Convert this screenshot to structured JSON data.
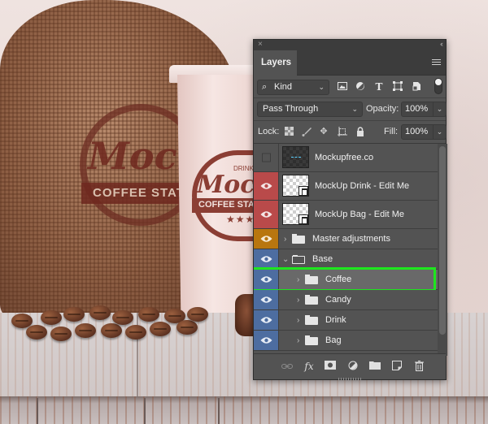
{
  "scene": {
    "bag_logo_text": "Mock",
    "bag_band_text": "COFFEE STAT",
    "cup_small_text": "DRINK",
    "cup_logo_text": "Mock",
    "cup_band_text": "COFFEE STAT",
    "cup_stars": "★★★"
  },
  "panel": {
    "close_icon": "×",
    "collapse_icon": "‹‹",
    "tab_label": "Layers",
    "filter": {
      "kind_label": "Kind",
      "kind_icon": "search-icon",
      "filter_icons": [
        "image-filter-icon",
        "adjustment-filter-icon",
        "type-filter-icon",
        "shape-filter-icon",
        "smart-object-filter-icon"
      ],
      "filter_toggle": "on"
    },
    "blend_mode": "Pass Through",
    "opacity_label": "Opacity:",
    "opacity_value": "100%",
    "lock_label": "Lock:",
    "lock_icons": [
      "lock-transparent-pixels-icon",
      "lock-image-pixels-icon",
      "lock-position-icon",
      "lock-artboard-icon",
      "lock-all-icon"
    ],
    "fill_label": "Fill:",
    "fill_value": "100%",
    "layers": [
      {
        "name": "Mockupfree.co",
        "visible": false,
        "type": "layer",
        "thumb": "dark",
        "indent": 0
      },
      {
        "name": "MockUp Drink - Edit Me",
        "visible": true,
        "color": "#b94a4a",
        "type": "smart-object",
        "indent": 0
      },
      {
        "name": "MockUp Bag - Edit Me",
        "visible": true,
        "color": "#b94a4a",
        "type": "smart-object",
        "indent": 0
      },
      {
        "name": "Master adjustments",
        "visible": true,
        "color": "#b8760f",
        "type": "group",
        "expanded": false,
        "indent": 0
      },
      {
        "name": "Base",
        "visible": true,
        "color": "#4d6da0",
        "type": "group",
        "expanded": true,
        "indent": 0
      },
      {
        "name": "Coffee",
        "visible": true,
        "color": "#4d6da0",
        "type": "group",
        "expanded": false,
        "indent": 1,
        "selected": true,
        "highlighted": true
      },
      {
        "name": "Candy",
        "visible": true,
        "color": "#4d6da0",
        "type": "group",
        "expanded": false,
        "indent": 1
      },
      {
        "name": "Drink",
        "visible": true,
        "color": "#4d6da0",
        "type": "group",
        "expanded": false,
        "indent": 1
      },
      {
        "name": "Bag",
        "visible": true,
        "color": "#4d6da0",
        "type": "group",
        "expanded": false,
        "indent": 1
      }
    ],
    "footer_icons": [
      "link-layers-icon",
      "fx-icon",
      "add-mask-icon",
      "adjustment-layer-icon",
      "new-group-icon",
      "new-layer-icon",
      "delete-layer-icon"
    ],
    "highlight_color": "#1ee61e"
  }
}
